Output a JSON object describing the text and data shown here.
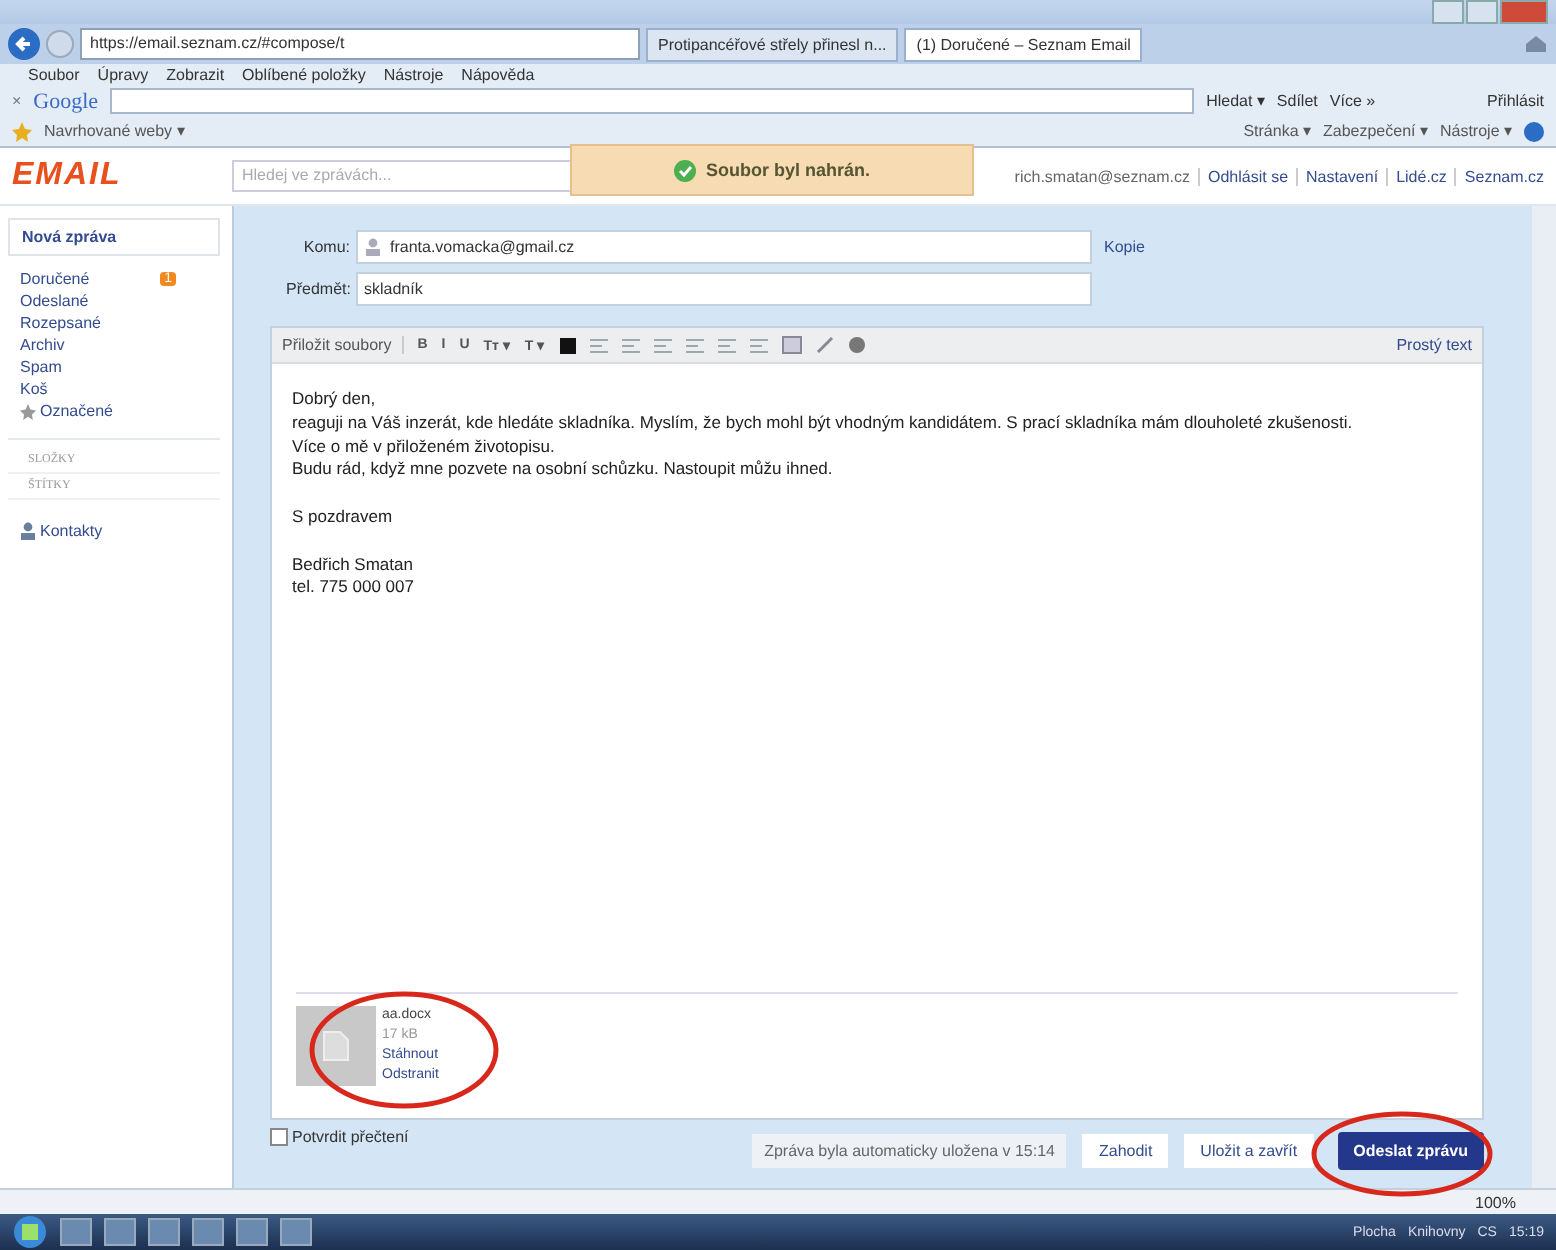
{
  "browser": {
    "url": "https://email.seznam.cz/#compose/t",
    "tabs": [
      {
        "label": "Protipancéřové střely přinesl n...",
        "selected": false
      },
      {
        "label": "(1) Doručené – Seznam Email",
        "selected": true
      }
    ],
    "menu": [
      "Soubor",
      "Úpravy",
      "Zobrazit",
      "Oblíbené položky",
      "Nástroje",
      "Nápověda"
    ],
    "google_toolbar": {
      "close": "×",
      "brand": "Google",
      "search": "Hledat ▾",
      "share": "Sdílet",
      "more": "Více »",
      "login": "Přihlásit"
    },
    "favorites": "Navrhované weby ▾",
    "commands": [
      "Stránka ▾",
      "Zabezpečení ▾",
      "Nástroje ▾"
    ],
    "zoom": "100%"
  },
  "header": {
    "logo": "EMAIL",
    "search": {
      "placeholder": "Hledej ve zprávách..."
    },
    "toast": "Soubor byl nahrán.",
    "links": [
      "rich.smatan@seznam.cz",
      "Odhlásit se",
      "Nastavení",
      "Lidé.cz",
      "Seznam.cz"
    ]
  },
  "sidebar": {
    "new_message": "Nová zpráva",
    "items": [
      {
        "label": "Doručené",
        "badge": "1",
        "starred": false
      },
      {
        "label": "Odeslané",
        "starred": false
      },
      {
        "label": "Rozepsané",
        "starred": false
      },
      {
        "label": "Archiv",
        "starred": false
      },
      {
        "label": "Spam",
        "starred": false
      },
      {
        "label": "Koš",
        "starred": false
      },
      {
        "label": "Označené",
        "starred": true
      }
    ],
    "sections": [
      "SLOŽKY",
      "ŠTÍTKY"
    ],
    "contacts": "Kontakty"
  },
  "compose": {
    "to_label": "Komu:",
    "to": "franta.vomacka@gmail.cz",
    "cc": "Kopie",
    "subject_label": "Předmět:",
    "subject": "skladník",
    "attach": "Přiložit soubory",
    "format_buttons": [
      "B",
      "I",
      "U",
      "Tт ▾",
      "T ▾"
    ],
    "plain_text": "Prostý text",
    "body": [
      [
        "Dobrý den,",
        "reaguji na Váš inzerát, kde hledáte skladníka. Myslím, že bych mohl být vhodným kandidátem. S prací skladníka mám dlouholeté zkušenosti.",
        "Více o mě v přiloženém životopisu.",
        "Budu rád, když mne pozvete na osobní schůzku. Nastoupit můžu ihned."
      ],
      [
        "S pozdravem"
      ],
      [
        "Bedřich Smatan",
        "tel. 775 000 007"
      ]
    ],
    "attachment": {
      "name": "aa.docx",
      "size": "17 kB",
      "download": "Stáhnout",
      "remove": "Odstranit"
    },
    "read_receipt": {
      "label": "Potvrdit přečtení",
      "checked": false
    },
    "autosave": "Zpráva byla automaticky uložena v 15:14",
    "buttons": [
      "Zahodit",
      "Uložit a zavřít"
    ],
    "send": "Odeslat zprávu"
  },
  "taskbar": {
    "desktop": "Plocha",
    "library": "Knihovny",
    "language": "CS",
    "time": "15:19"
  }
}
